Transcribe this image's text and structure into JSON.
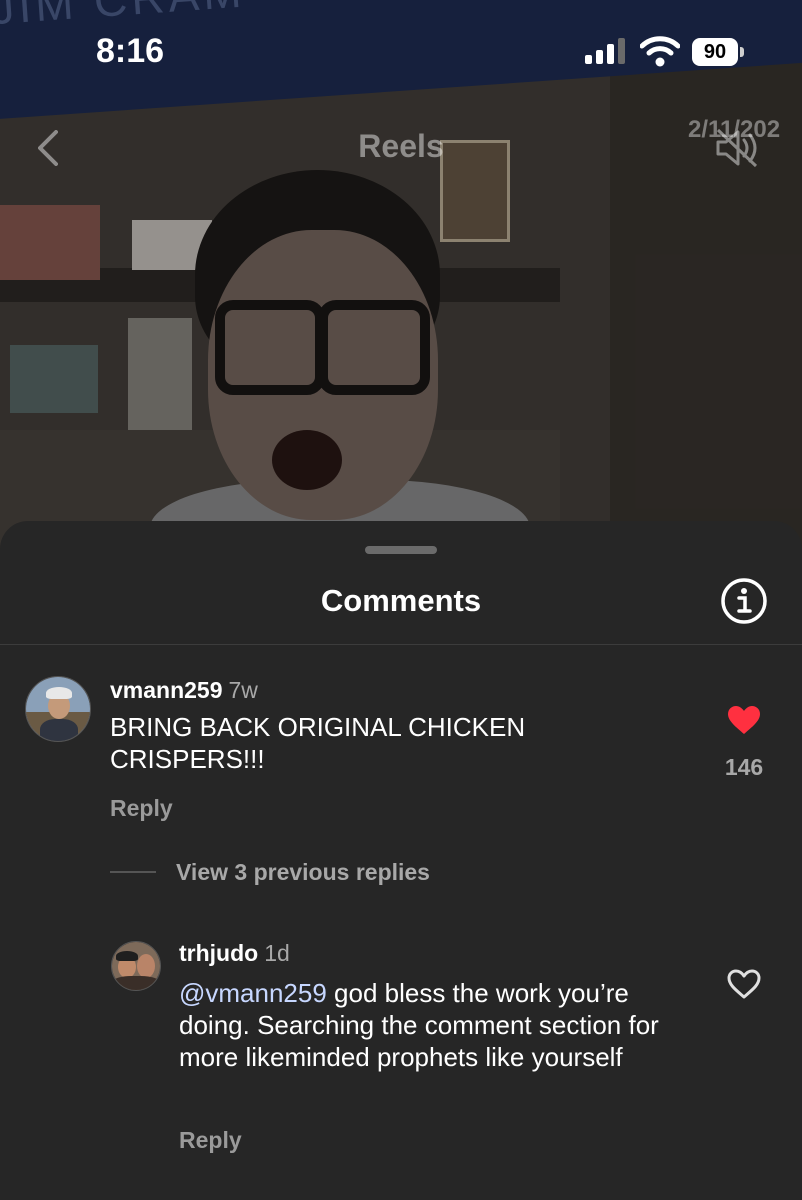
{
  "status_bar": {
    "time": "8:16",
    "battery": "90"
  },
  "video": {
    "banner_text": "JIM CRAM",
    "header_title": "Reels",
    "date_overlay": "2/11/202"
  },
  "comments_sheet": {
    "title": "Comments",
    "comments": [
      {
        "username": "vmann259",
        "time": "7w",
        "text": "BRING BACK ORIGINAL CHICKEN CRISPERS!!!",
        "like_count": "146",
        "liked": true,
        "reply_label": "Reply"
      }
    ],
    "view_replies_label": "View 3 previous replies",
    "reply": {
      "username": "trhjudo",
      "time": "1d",
      "mention": "@vmann259",
      "text": " god bless the work you’re doing. Searching the comment section for more likeminded prophets like yourself",
      "liked": false,
      "reply_label": "Reply"
    }
  },
  "colors": {
    "sheet_background": "#262626",
    "like_red": "#ff3040",
    "mention_blue": "#c7d7ff",
    "muted_text": "#a8a8a8"
  },
  "icons": [
    "signal-icon",
    "wifi-icon",
    "battery-icon",
    "back-chevron-icon",
    "mute-icon",
    "info-icon",
    "heart-filled-icon",
    "heart-outline-icon"
  ]
}
